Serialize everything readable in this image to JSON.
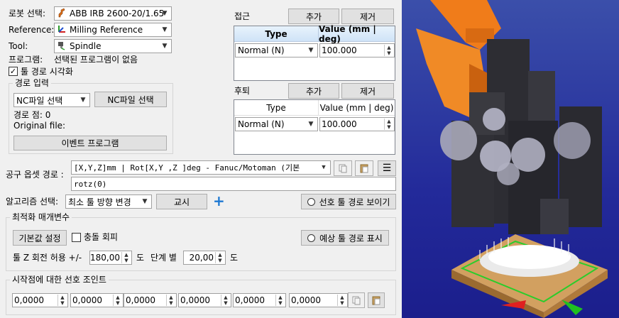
{
  "robot": {
    "label": "로봇 선택:",
    "value": "ABB IRB 2600-20/1.65"
  },
  "reference": {
    "label": "Reference:",
    "value": "Milling Reference"
  },
  "tool": {
    "label": "Tool:",
    "value": "Spindle"
  },
  "program": {
    "label": "프로그램:",
    "value": "선택된 프로그램이 없음"
  },
  "show_toolpath": {
    "label": "툴 경로 시각화",
    "checked": true
  },
  "path_input": {
    "title": "경로 입력",
    "nc_combo": "NC파일 선택",
    "nc_button": "NC파일 선택",
    "path_points": "경로 점: 0",
    "original_file": "Original file:",
    "event_button": "이벤트 프로그램"
  },
  "approach": {
    "label": "접근",
    "add": "추가",
    "remove": "제거",
    "col_type": "Type",
    "col_value": "Value (mm | deg)",
    "row_type": "Normal (N)",
    "row_value": "100.000"
  },
  "retract": {
    "label": "후퇴",
    "add": "추가",
    "remove": "제거",
    "col_type": "Type",
    "col_value": "Value (mm | deg)",
    "row_type": "Normal (N)",
    "row_value": "100.000"
  },
  "tool_offset": {
    "label": "공구 옵셋 경로 :",
    "combo": "[X,Y,Z]mm | Rot[X,Y ,Z  ]deg - Fanuc/Motoman (기본",
    "text": "rotz(0)"
  },
  "algorithm": {
    "label": "알고리즘 선택:",
    "combo": "최소 툴 방향 변경",
    "teach_button": "교시",
    "preferred_button": "선호 툴 경로 보이기"
  },
  "optimization": {
    "title": "최적화 매개변수",
    "default_button": "기본값 설정",
    "collision_label": "충돌 회피",
    "collision_checked": false,
    "expected_button": "예상 툴 경로 표시",
    "rotz_label": "툴 Z 회전 허용 +/-",
    "rotz_value": "180,00",
    "deg_unit": "도",
    "step_label": "단계 별",
    "step_value": "20,00",
    "deg_unit2": "도"
  },
  "preferred_joints": {
    "title": "시작점에 대한 선호 조인트",
    "values": [
      "0,0000",
      "0,0000",
      "0,0000",
      "0,0000",
      "0,0000",
      "0,0000"
    ]
  },
  "colors": {
    "accent_blue": "#1e78d2",
    "robot_orange": "#f07c1a",
    "viewport_top": "#3a4fa8",
    "viewport_bottom": "#1b1e8c"
  }
}
